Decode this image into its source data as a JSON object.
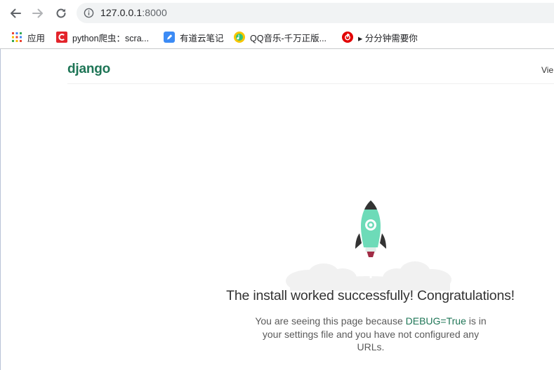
{
  "browser": {
    "nav": {
      "back_icon": "arrow-left-icon",
      "forward_icon": "arrow-right-icon",
      "reload_icon": "reload-icon"
    },
    "omnibox": {
      "info_icon": "info-icon",
      "url_host": "127.0.0.1",
      "url_port": ":8000"
    },
    "bookmarks": [
      {
        "label": "应用",
        "icon": "apps-grid-icon"
      },
      {
        "label": "python爬虫：scra...",
        "icon": "csdn-icon"
      },
      {
        "label": "有道云笔记",
        "icon": "youdao-note-icon"
      },
      {
        "label": "QQ音乐-千万正版...",
        "icon": "qq-music-icon"
      },
      {
        "label": "▸ 分分钟需要你",
        "icon": "netease-music-icon"
      }
    ]
  },
  "page": {
    "logo": "django",
    "header_right": "Vie",
    "headline": "The install worked successfully! Congratulations!",
    "subtext_before": "You are seeing this page because ",
    "subtext_debug": "DEBUG=True",
    "subtext_after": " is in your settings file and you have not configured any URLs.",
    "colors": {
      "brand_green": "#1e7556",
      "rocket_body": "#6ddbb8",
      "rocket_fins": "#333333",
      "rocket_nozzle": "#a12c45",
      "clouds": "#f0f0f0"
    }
  }
}
